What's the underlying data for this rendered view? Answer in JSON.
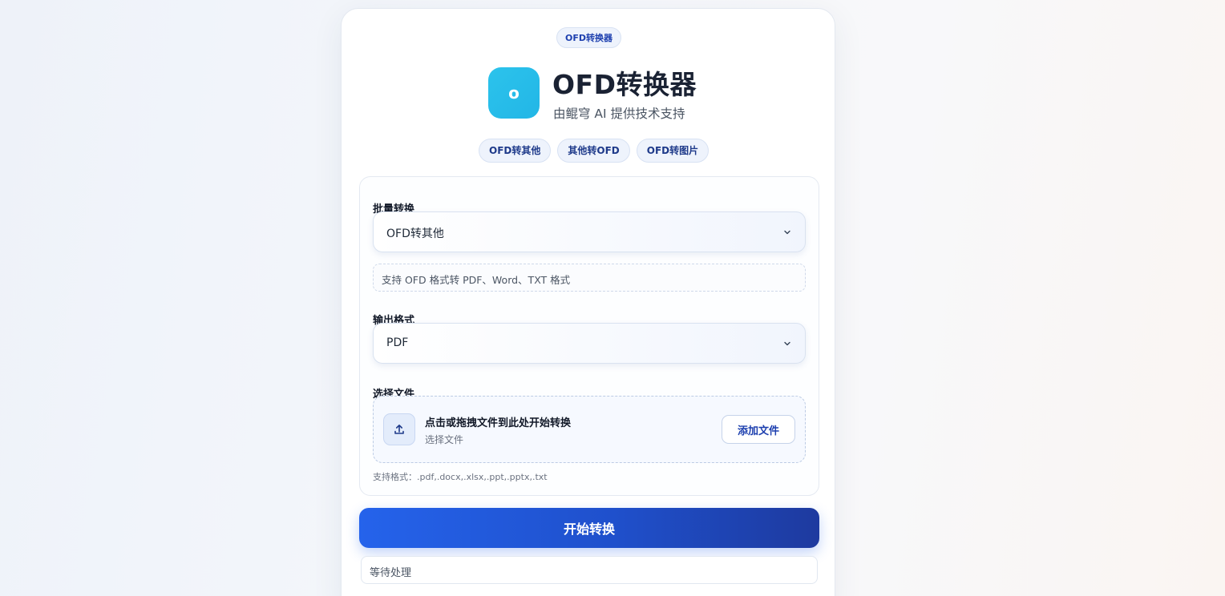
{
  "header": {
    "tag": "OFD转换器",
    "logo_letter": "o",
    "title": "OFD转换器",
    "subtitle": "由鲲穹 AI 提供技术支持"
  },
  "tabs": [
    {
      "label": "OFD转其他"
    },
    {
      "label": "其他转OFD"
    },
    {
      "label": "OFD转图片"
    }
  ],
  "form": {
    "batch_label": "批量转换",
    "batch_value": "OFD转其他",
    "hint": "支持 OFD 格式转 PDF、Word、TXT 格式",
    "output_label": "输出格式",
    "output_value": "PDF",
    "file_label": "选择文件",
    "drop_title": "点击或拖拽文件到此处开始转换",
    "drop_sub": "选择文件",
    "add_button": "添加文件",
    "formats": "支持格式：.pdf,.docx,.xlsx,.ppt,.pptx,.txt"
  },
  "actions": {
    "start_button": "开始转换",
    "status": "等待处理"
  },
  "colors": {
    "accent": "#2563eb",
    "logo": "#2cc3ec",
    "tag_text": "#1e40af"
  },
  "icons": {
    "chevron": "chevron-down-icon",
    "upload": "upload-icon"
  }
}
